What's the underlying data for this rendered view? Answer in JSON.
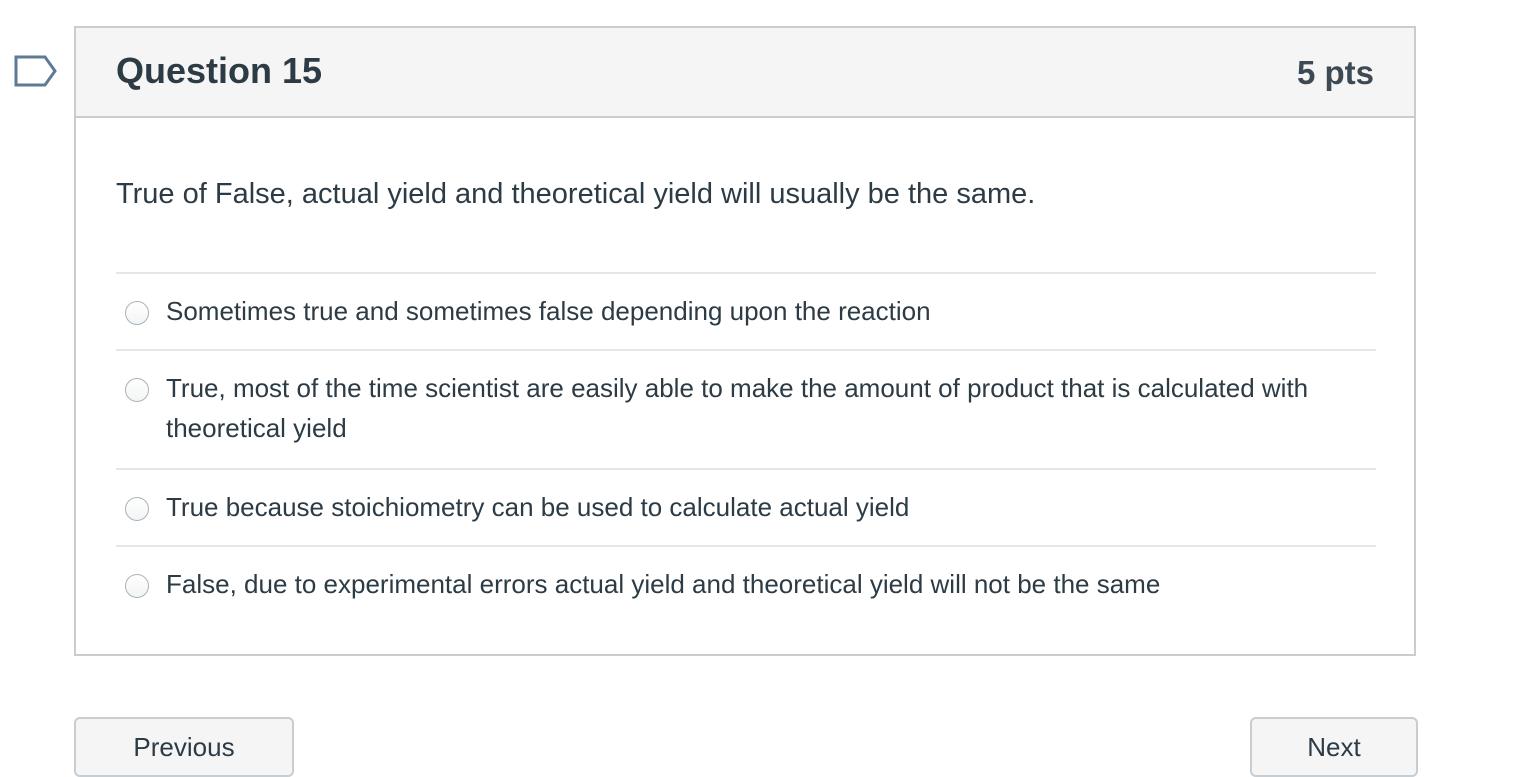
{
  "question": {
    "title": "Question 15",
    "points": "5 pts",
    "text": "True of False, actual yield and theoretical yield will usually be the same.",
    "flag_icon": "bookmark-flag-icon",
    "answers": [
      {
        "label": "Sometimes true and sometimes false depending upon the reaction"
      },
      {
        "label": "True, most of the time scientist are easily able to make the amount of product that is calculated with theoretical yield"
      },
      {
        "label": "True because stoichiometry can be used to calculate actual yield"
      },
      {
        "label": "False, due to experimental errors actual yield and theoretical yield will not be the same"
      }
    ]
  },
  "navigation": {
    "previous_label": "Previous",
    "next_label": "Next"
  },
  "colors": {
    "border": "#c7cdd1",
    "header_bg": "#f5f5f5",
    "text": "#2d3b45",
    "flag": "#5e7a94"
  }
}
